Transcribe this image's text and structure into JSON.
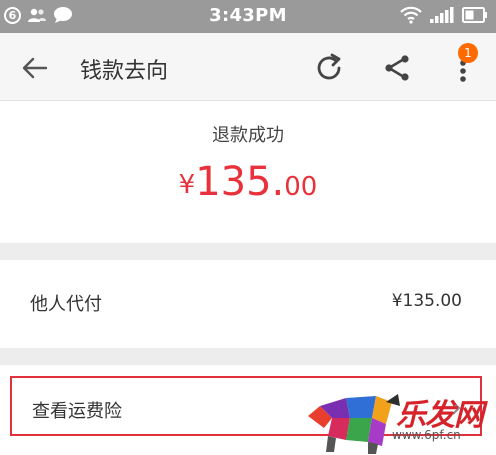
{
  "status_bar": {
    "notification_count": "6",
    "time": "3:43PM",
    "icons": [
      "notification-count-icon",
      "contacts-icon",
      "chat-bubble-icon",
      "wifi-icon",
      "signal-icon",
      "battery-icon"
    ]
  },
  "app_bar": {
    "title": "钱款去向",
    "more_badge": "1",
    "icons": [
      "back-arrow-icon",
      "refresh-icon",
      "share-icon",
      "more-vertical-icon"
    ]
  },
  "refund": {
    "status": "退款成功",
    "currency_symbol": "¥",
    "amount_integer": "135.",
    "amount_decimal": "00"
  },
  "payer": {
    "label": "他人代付",
    "amount": "¥135.00"
  },
  "insurance": {
    "label": "查看运费险"
  },
  "watermark": {
    "text": "乐发网",
    "url": "www.6pf.cn"
  },
  "colors": {
    "status_bar": "#9a9a9a",
    "app_bar": "#f6f6f6",
    "amount_red": "#e8313a",
    "badge_orange": "#ff6a00",
    "highlight_border": "#e0323a",
    "divider_gray": "#ededed"
  }
}
